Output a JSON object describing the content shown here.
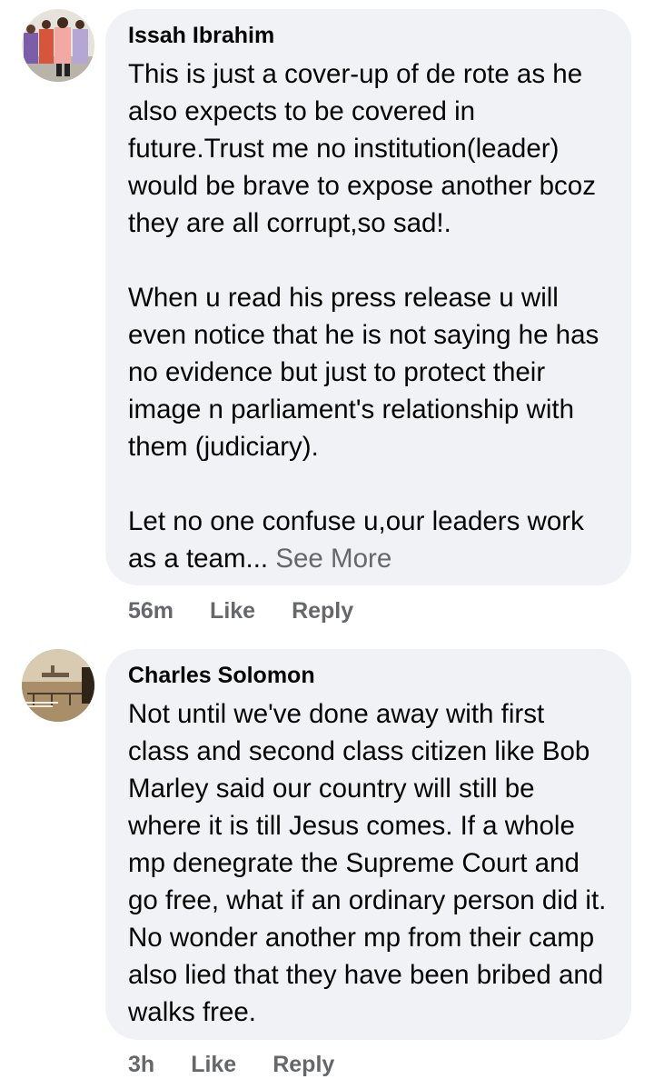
{
  "comments": [
    {
      "author": "Issah Ibrahim",
      "avatar_icon": "profile-photo-group-icon",
      "paragraphs": [
        "This is just a cover-up of de rote as he also expects to be covered in future.Trust me no institution(leader) would be brave to expose another bcoz they are all corrupt,so sad!.",
        "When u read his press release u will even notice that he is not saying he has no evidence but just to protect their image n parliament's relationship with them (judiciary).",
        "Let no one confuse u,our leaders work as a team..."
      ],
      "see_more": "See More",
      "time": "56m",
      "like": "Like",
      "reply": "Reply"
    },
    {
      "author": "Charles Solomon",
      "avatar_icon": "profile-photo-ship-icon",
      "paragraphs": [
        "Not until we've done away with first class and second class citizen like Bob Marley said our country will still be where it is till Jesus comes. If a whole mp denegrate the Supreme Court and go free, what if an ordinary person did it. No wonder another mp from their camp also lied that they have been bribed and walks free."
      ],
      "time": "3h",
      "like": "Like",
      "reply": "Reply"
    }
  ],
  "colors": {
    "bubble": "#f0f2f5",
    "text": "#050505",
    "secondary": "#65676b"
  }
}
